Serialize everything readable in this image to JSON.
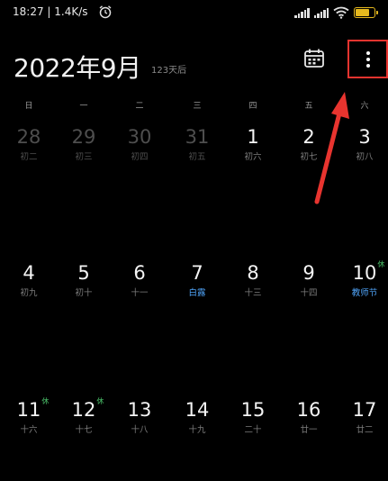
{
  "status_bar": {
    "time": "18:27 | 1.4K/s",
    "battery_color": "#e6b91e"
  },
  "header": {
    "title": "2022年9月",
    "subtitle": "123天后"
  },
  "weekdays": [
    "日",
    "一",
    "二",
    "三",
    "四",
    "五",
    "六"
  ],
  "weeks": [
    [
      {
        "day": "28",
        "sub": "初二",
        "other": true
      },
      {
        "day": "29",
        "sub": "初三",
        "other": true
      },
      {
        "day": "30",
        "sub": "初四",
        "other": true
      },
      {
        "day": "31",
        "sub": "初五",
        "other": true
      },
      {
        "day": "1",
        "sub": "初六"
      },
      {
        "day": "2",
        "sub": "初七"
      },
      {
        "day": "3",
        "sub": "初八"
      }
    ],
    [
      {
        "day": "4",
        "sub": "初九"
      },
      {
        "day": "5",
        "sub": "初十"
      },
      {
        "day": "6",
        "sub": "十一"
      },
      {
        "day": "7",
        "sub": "白露",
        "festival": true
      },
      {
        "day": "8",
        "sub": "十三"
      },
      {
        "day": "9",
        "sub": "十四"
      },
      {
        "day": "10",
        "sub": "教师节",
        "festival": true,
        "badge": "休"
      }
    ],
    [
      {
        "day": "11",
        "sub": "十六",
        "badge": "休"
      },
      {
        "day": "12",
        "sub": "十七",
        "badge": "休"
      },
      {
        "day": "13",
        "sub": "十八"
      },
      {
        "day": "14",
        "sub": "十九"
      },
      {
        "day": "15",
        "sub": "二十"
      },
      {
        "day": "16",
        "sub": "廿一"
      },
      {
        "day": "17",
        "sub": "廿二"
      }
    ]
  ],
  "colors": {
    "festival": "#4fa3f7",
    "holiday_badge": "#4cc36b",
    "highlight": "#e8342f"
  }
}
